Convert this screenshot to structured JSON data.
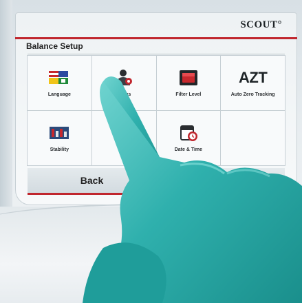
{
  "brand": {
    "logo_text": "SCOUT°"
  },
  "screen": {
    "section_title": "Balance Setup",
    "tiles": [
      {
        "label": "Language",
        "icon": "language-flags-icon"
      },
      {
        "label": "...ings",
        "icon": "user-settings-icon"
      },
      {
        "label": "Filter Level",
        "icon": "filter-level-icon"
      },
      {
        "label": "Auto Zero Tracking",
        "icon_text": "AZT"
      },
      {
        "label": "Stability",
        "icon": "stability-icon"
      },
      {
        "label": "A...",
        "icon": "obscured-icon"
      },
      {
        "label": "Date & Time",
        "icon": "calendar-clock-icon"
      },
      {
        "label": "",
        "icon": ""
      }
    ],
    "buttons": {
      "back": "Back",
      "exit": "...t"
    }
  },
  "colors": {
    "accent_red": "#c0262d",
    "glove": "#34b8b6",
    "screen_bg": "#f7f9fa"
  }
}
